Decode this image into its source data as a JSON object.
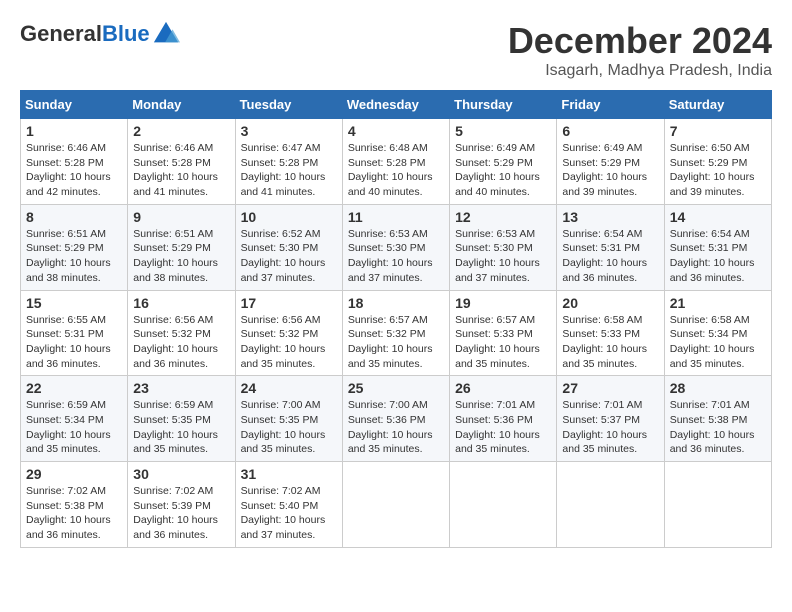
{
  "logo": {
    "general": "General",
    "blue": "Blue"
  },
  "header": {
    "month": "December 2024",
    "location": "Isagarh, Madhya Pradesh, India"
  },
  "weekdays": [
    "Sunday",
    "Monday",
    "Tuesday",
    "Wednesday",
    "Thursday",
    "Friday",
    "Saturday"
  ],
  "weeks": [
    [
      {
        "day": 1,
        "sunrise": "6:46 AM",
        "sunset": "5:28 PM",
        "daylight": "10 hours and 42 minutes."
      },
      {
        "day": 2,
        "sunrise": "6:46 AM",
        "sunset": "5:28 PM",
        "daylight": "10 hours and 41 minutes."
      },
      {
        "day": 3,
        "sunrise": "6:47 AM",
        "sunset": "5:28 PM",
        "daylight": "10 hours and 41 minutes."
      },
      {
        "day": 4,
        "sunrise": "6:48 AM",
        "sunset": "5:28 PM",
        "daylight": "10 hours and 40 minutes."
      },
      {
        "day": 5,
        "sunrise": "6:49 AM",
        "sunset": "5:29 PM",
        "daylight": "10 hours and 40 minutes."
      },
      {
        "day": 6,
        "sunrise": "6:49 AM",
        "sunset": "5:29 PM",
        "daylight": "10 hours and 39 minutes."
      },
      {
        "day": 7,
        "sunrise": "6:50 AM",
        "sunset": "5:29 PM",
        "daylight": "10 hours and 39 minutes."
      }
    ],
    [
      {
        "day": 8,
        "sunrise": "6:51 AM",
        "sunset": "5:29 PM",
        "daylight": "10 hours and 38 minutes."
      },
      {
        "day": 9,
        "sunrise": "6:51 AM",
        "sunset": "5:29 PM",
        "daylight": "10 hours and 38 minutes."
      },
      {
        "day": 10,
        "sunrise": "6:52 AM",
        "sunset": "5:30 PM",
        "daylight": "10 hours and 37 minutes."
      },
      {
        "day": 11,
        "sunrise": "6:53 AM",
        "sunset": "5:30 PM",
        "daylight": "10 hours and 37 minutes."
      },
      {
        "day": 12,
        "sunrise": "6:53 AM",
        "sunset": "5:30 PM",
        "daylight": "10 hours and 37 minutes."
      },
      {
        "day": 13,
        "sunrise": "6:54 AM",
        "sunset": "5:31 PM",
        "daylight": "10 hours and 36 minutes."
      },
      {
        "day": 14,
        "sunrise": "6:54 AM",
        "sunset": "5:31 PM",
        "daylight": "10 hours and 36 minutes."
      }
    ],
    [
      {
        "day": 15,
        "sunrise": "6:55 AM",
        "sunset": "5:31 PM",
        "daylight": "10 hours and 36 minutes."
      },
      {
        "day": 16,
        "sunrise": "6:56 AM",
        "sunset": "5:32 PM",
        "daylight": "10 hours and 36 minutes."
      },
      {
        "day": 17,
        "sunrise": "6:56 AM",
        "sunset": "5:32 PM",
        "daylight": "10 hours and 35 minutes."
      },
      {
        "day": 18,
        "sunrise": "6:57 AM",
        "sunset": "5:32 PM",
        "daylight": "10 hours and 35 minutes."
      },
      {
        "day": 19,
        "sunrise": "6:57 AM",
        "sunset": "5:33 PM",
        "daylight": "10 hours and 35 minutes."
      },
      {
        "day": 20,
        "sunrise": "6:58 AM",
        "sunset": "5:33 PM",
        "daylight": "10 hours and 35 minutes."
      },
      {
        "day": 21,
        "sunrise": "6:58 AM",
        "sunset": "5:34 PM",
        "daylight": "10 hours and 35 minutes."
      }
    ],
    [
      {
        "day": 22,
        "sunrise": "6:59 AM",
        "sunset": "5:34 PM",
        "daylight": "10 hours and 35 minutes."
      },
      {
        "day": 23,
        "sunrise": "6:59 AM",
        "sunset": "5:35 PM",
        "daylight": "10 hours and 35 minutes."
      },
      {
        "day": 24,
        "sunrise": "7:00 AM",
        "sunset": "5:35 PM",
        "daylight": "10 hours and 35 minutes."
      },
      {
        "day": 25,
        "sunrise": "7:00 AM",
        "sunset": "5:36 PM",
        "daylight": "10 hours and 35 minutes."
      },
      {
        "day": 26,
        "sunrise": "7:01 AM",
        "sunset": "5:36 PM",
        "daylight": "10 hours and 35 minutes."
      },
      {
        "day": 27,
        "sunrise": "7:01 AM",
        "sunset": "5:37 PM",
        "daylight": "10 hours and 35 minutes."
      },
      {
        "day": 28,
        "sunrise": "7:01 AM",
        "sunset": "5:38 PM",
        "daylight": "10 hours and 36 minutes."
      }
    ],
    [
      {
        "day": 29,
        "sunrise": "7:02 AM",
        "sunset": "5:38 PM",
        "daylight": "10 hours and 36 minutes."
      },
      {
        "day": 30,
        "sunrise": "7:02 AM",
        "sunset": "5:39 PM",
        "daylight": "10 hours and 36 minutes."
      },
      {
        "day": 31,
        "sunrise": "7:02 AM",
        "sunset": "5:40 PM",
        "daylight": "10 hours and 37 minutes."
      },
      null,
      null,
      null,
      null
    ]
  ]
}
